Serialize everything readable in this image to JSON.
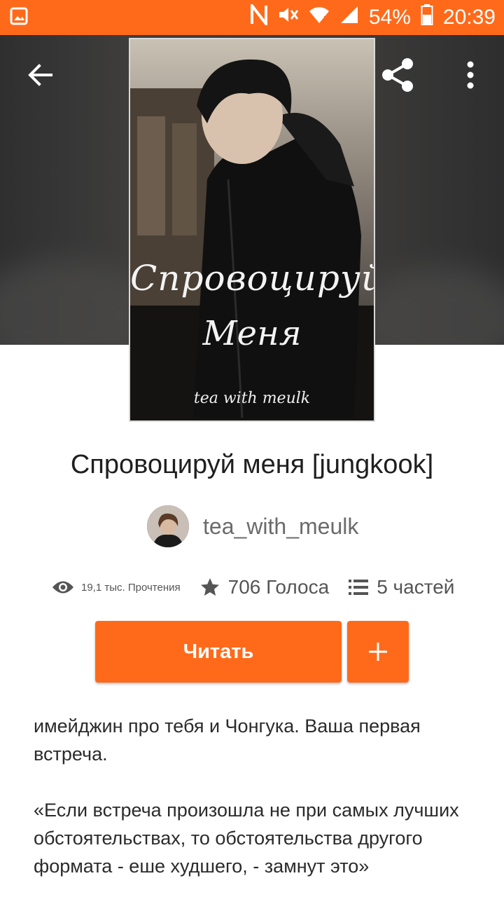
{
  "status_bar": {
    "battery": "54%",
    "time": "20:39",
    "icons": [
      "gallery-icon",
      "nfc-icon",
      "mute-icon",
      "wifi-icon",
      "signal-icon",
      "battery-icon"
    ]
  },
  "toolbar": {
    "icons": [
      "back-arrow-icon",
      "share-icon",
      "more-vert-icon"
    ]
  },
  "cover": {
    "title_line1": "Спровоцируй",
    "title_line2": "Меня",
    "author": "tea with meulk"
  },
  "story": {
    "title": "Спровоцируй меня [jungkook]",
    "author": "tea_with_meulk",
    "reads": "19,1 тыс. Прочтения",
    "votes": "706 Голоса",
    "parts": "5 частей"
  },
  "actions": {
    "read_label": "Читать",
    "add_label": "+"
  },
  "description": {
    "paragraph1": "имейджин про тебя и Чонгука. Ваша первая встреча.",
    "paragraph2": "«Если встреча произошла не при самых лучших обстоятельствах, то обстоятельства другого формата - еше худшего, - замнут это»"
  },
  "colors": {
    "accent": "#ff6a1a",
    "header_bg": "#3a3938",
    "text_primary": "#1f1f1f",
    "text_secondary": "#6b6b6b"
  }
}
